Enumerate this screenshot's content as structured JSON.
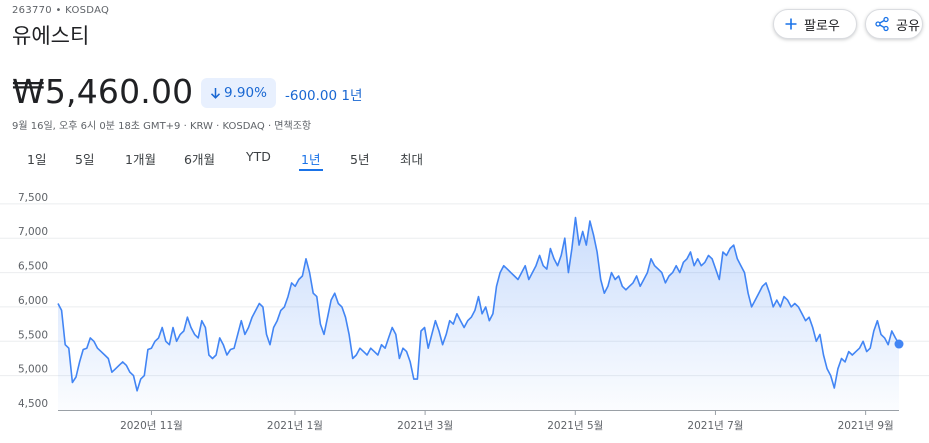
{
  "header": {
    "ticker": "263770 • KOSDAQ",
    "name": "유에스티",
    "follow_label": "팔로우",
    "share_label": "공유"
  },
  "quote": {
    "price": "₩5,460.00",
    "change_pct": "9.90%",
    "change_abs": "-600.00 1년",
    "meta": "9월 16일, 오후 6시 0분 18초 GMT+9 · KRW · KOSDAQ · 면책조항"
  },
  "ranges": [
    {
      "label": "1일",
      "active": false
    },
    {
      "label": "5일",
      "active": false
    },
    {
      "label": "1개월",
      "active": false
    },
    {
      "label": "6개월",
      "active": false
    },
    {
      "label": "YTD",
      "active": false
    },
    {
      "label": "1년",
      "active": true
    },
    {
      "label": "5년",
      "active": false
    },
    {
      "label": "최대",
      "active": false
    }
  ],
  "colors": {
    "line": "#4285f4",
    "accent": "#1a73e8",
    "negative": "#1967d2"
  },
  "icons": {
    "follow": "plus-icon",
    "share": "share-icon",
    "change": "arrow-down-icon"
  },
  "chart_data": {
    "type": "area",
    "ylim": [
      4500,
      7600
    ],
    "yticks": [
      4500,
      5000,
      5500,
      6000,
      6500,
      7000,
      7500
    ],
    "ytick_labels": [
      "4,500",
      "5,000",
      "5,500",
      "6,000",
      "6,500",
      "7,000",
      "7,500"
    ],
    "xlim": [
      0,
      252
    ],
    "xticks": [
      {
        "pos": 28,
        "label": "2020년 11월"
      },
      {
        "pos": 71,
        "label": "2021년 1월"
      },
      {
        "pos": 110,
        "label": "2021년 3월"
      },
      {
        "pos": 155,
        "label": "2021년 5월"
      },
      {
        "pos": 197,
        "label": "2021년 7월"
      },
      {
        "pos": 242,
        "label": "2021년 9월"
      }
    ],
    "grid": true,
    "series": [
      {
        "values": [
          6050,
          5950,
          5450,
          5400,
          4900,
          4980,
          5200,
          5380,
          5400,
          5550,
          5500,
          5400,
          5350,
          5300,
          5250,
          5050,
          5100,
          5150,
          5200,
          5150,
          5050,
          5000,
          4780,
          4950,
          5000,
          5380,
          5400,
          5500,
          5550,
          5700,
          5500,
          5450,
          5700,
          5500,
          5600,
          5650,
          5850,
          5700,
          5600,
          5550,
          5800,
          5700,
          5300,
          5250,
          5300,
          5550,
          5450,
          5300,
          5380,
          5400,
          5600,
          5800,
          5600,
          5700,
          5850,
          5950,
          6050,
          6000,
          5600,
          5450,
          5700,
          5800,
          5950,
          6000,
          6150,
          6350,
          6300,
          6400,
          6450,
          6700,
          6500,
          6200,
          6150,
          5750,
          5600,
          5850,
          6100,
          6200,
          6050,
          6000,
          5850,
          5600,
          5250,
          5300,
          5400,
          5350,
          5300,
          5400,
          5350,
          5300,
          5450,
          5400,
          5550,
          5700,
          5600,
          5250,
          5400,
          5350,
          5200,
          4950,
          4950,
          5650,
          5700,
          5400,
          5600,
          5800,
          5650,
          5450,
          5600,
          5800,
          5750,
          5900,
          5800,
          5700,
          5800,
          5850,
          5950,
          6150,
          5900,
          6000,
          5800,
          5900,
          6300,
          6500,
          6600,
          6550,
          6500,
          6450,
          6400,
          6500,
          6600,
          6400,
          6500,
          6600,
          6750,
          6600,
          6550,
          6850,
          6700,
          6600,
          6750,
          7000,
          6500,
          6850,
          7300,
          6900,
          7100,
          6900,
          7250,
          7050,
          6800,
          6400,
          6200,
          6300,
          6500,
          6400,
          6450,
          6300,
          6250,
          6300,
          6350,
          6450,
          6300,
          6400,
          6500,
          6700,
          6600,
          6550,
          6500,
          6350,
          6450,
          6500,
          6600,
          6500,
          6650,
          6700,
          6800,
          6600,
          6700,
          6600,
          6650,
          6750,
          6700,
          6550,
          6400,
          6800,
          6750,
          6850,
          6900,
          6700,
          6600,
          6500,
          6200,
          6000,
          6100,
          6200,
          6300,
          6350,
          6200,
          6000,
          6100,
          6000,
          6150,
          6100,
          6000,
          6050,
          6000,
          5900,
          5800,
          5850,
          5700,
          5500,
          5600,
          5300,
          5100,
          5000,
          4820,
          5100,
          5250,
          5200,
          5350,
          5300,
          5350,
          5400,
          5500,
          5350,
          5400,
          5650,
          5800,
          5600,
          5550,
          5450,
          5650,
          5550,
          5460
        ]
      }
    ]
  }
}
